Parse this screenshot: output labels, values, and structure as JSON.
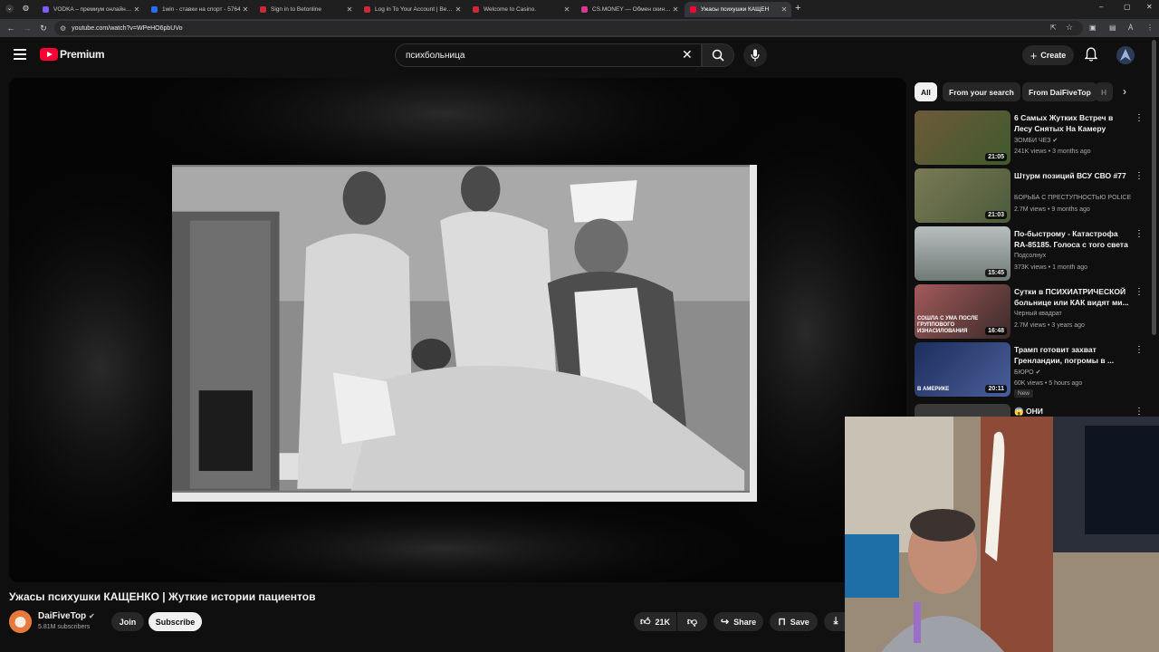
{
  "browser": {
    "tabs": [
      {
        "title": "VODKA – премиум онлайн-ка",
        "color": "#7c5cff"
      },
      {
        "title": "1win - ставки на спорт - 5764",
        "color": "#2a6cf6"
      },
      {
        "title": "Sign in to Betonline",
        "color": "#cc2a36"
      },
      {
        "title": "Log in To Your Account | BetOn",
        "color": "#cc2a36"
      },
      {
        "title": "Welcome to Casino.",
        "color": "#cc2a36"
      },
      {
        "title": "CS.MONEY — Обмен скинов",
        "color": "#d63a8f"
      },
      {
        "title": "Ужасы психушки КАЩЕН",
        "color": "#ff0033"
      }
    ],
    "url": "youtube.com/watch?v=WPeHO6pbUVo"
  },
  "header": {
    "logo_text": "Premium",
    "search_value": "психбольница",
    "create_label": "Create"
  },
  "video": {
    "title": "Ужасы психушки КАЩЕНКО | Жуткие истории пациентов",
    "channel": "DaiFiveTop",
    "subscribers": "5.81M subscribers",
    "join_label": "Join",
    "subscribe_label": "Subscribe",
    "likes": "21K",
    "share_label": "Share",
    "save_label": "Save"
  },
  "chips": [
    "All",
    "From your search",
    "From DaiFiveTop",
    "H"
  ],
  "recommendations": [
    {
      "title": "6 Самых Жутких Встреч в Лесу Снятых На Камеру",
      "channel": "ЗОМБИ ЧЕЗ",
      "verified": true,
      "meta": "241K views • 3 months ago",
      "duration": "21:05",
      "thumb": "#5e5a3a"
    },
    {
      "title": "Штурм позиций ВСУ СВО #77",
      "channel": "БОРЬБА С ПРЕСТУПНОСТЬЮ POLICE S...",
      "verified": false,
      "meta": "2.7M views • 9 months ago",
      "duration": "21:03",
      "thumb": "#6b6b48"
    },
    {
      "title": "По-быстрому - Катастрофа RA-85185. Голоса с того света",
      "channel": "Подсолнух",
      "verified": false,
      "meta": "373K views • 1 month ago",
      "duration": "15:45",
      "thumb": "#8a9493"
    },
    {
      "title": "Сутки в ПСИХИАТРИЧЕСКОЙ больнице или КАК видят ми...",
      "channel": "Черный квадрат",
      "verified": false,
      "meta": "2.7M views • 3 years ago",
      "duration": "16:48",
      "thumb": "#7a4a4a",
      "overlay": "СОШЛА С УМА ПОСЛЕ ГРУППОВОГО ИЗНАСИЛОВАНИЯ"
    },
    {
      "title": "Трамп готовит захват Гренландии, погромы в ...",
      "channel": "БЮРО",
      "verified": true,
      "meta": "60K views • 5 hours ago",
      "duration": "20:11",
      "thumb": "#2b3c66",
      "overlay": "В АМЕРИКЕ",
      "badge": "New"
    },
    {
      "title": "ОНИ",
      "channel": "",
      "verified": false,
      "meta": "",
      "duration": "",
      "thumb": "#3a3a3a",
      "emoji": "😱"
    }
  ]
}
